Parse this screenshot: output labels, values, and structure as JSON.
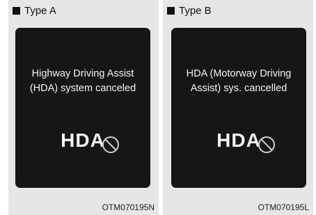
{
  "panels": [
    {
      "type_label": "Type A",
      "message_lines": [
        "Highway Driving Assist",
        "(HDA) system canceled"
      ],
      "indicator_text": "HDA",
      "indicator_icon": "cancel-circle-icon",
      "figure_code": "OTM070195N"
    },
    {
      "type_label": "Type B",
      "message_lines": [
        "HDA (Motorway Driving",
        "Assist) sys. cancelled"
      ],
      "indicator_text": "HDA",
      "indicator_icon": "cancel-circle-icon",
      "figure_code": "OTM070195L"
    }
  ],
  "colors": {
    "panel_bg": "#e6e6e6",
    "screen_bg": "#161616",
    "screen_text": "#f4f4f4"
  }
}
